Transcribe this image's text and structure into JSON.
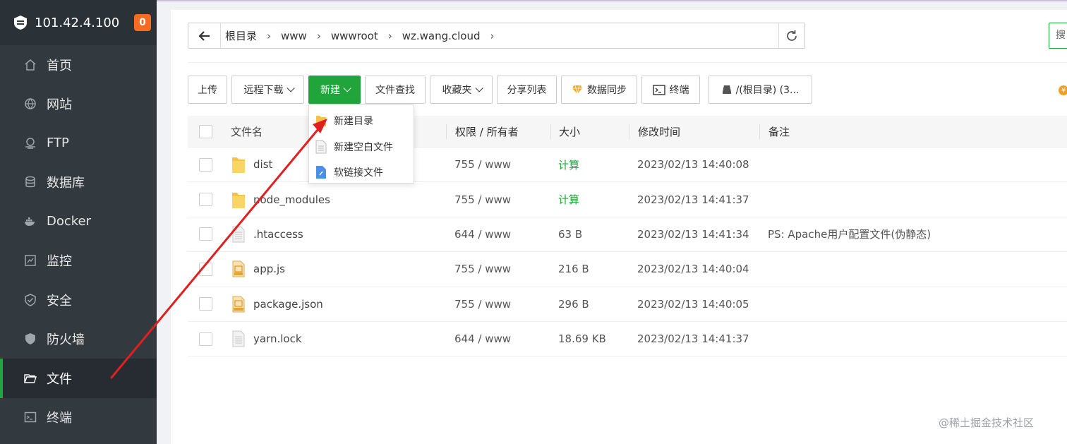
{
  "sidebar": {
    "server_ip": "101.42.4.100",
    "notification_count": "0",
    "items": [
      {
        "label": "首页",
        "icon": "home-icon"
      },
      {
        "label": "网站",
        "icon": "globe-icon"
      },
      {
        "label": "FTP",
        "icon": "ftp-icon"
      },
      {
        "label": "数据库",
        "icon": "database-icon"
      },
      {
        "label": "Docker",
        "icon": "docker-icon"
      },
      {
        "label": "监控",
        "icon": "monitor-icon"
      },
      {
        "label": "安全",
        "icon": "shield-check-icon"
      },
      {
        "label": "防火墙",
        "icon": "firewall-icon"
      },
      {
        "label": "文件",
        "icon": "folder-open-icon",
        "active": true
      },
      {
        "label": "终端",
        "icon": "terminal-icon"
      }
    ]
  },
  "path": {
    "crumbs": [
      "根目录",
      "www",
      "wwwroot",
      "wz.wang.cloud"
    ],
    "search_placeholder": "搜"
  },
  "toolbar": {
    "upload": "上传",
    "remote_download": "远程下载",
    "new": "新建",
    "file_search": "文件查找",
    "favorites": "收藏夹",
    "share_list": "分享列表",
    "data_sync": "数据同步",
    "terminal": "终端",
    "disk": "/(根目录) (3..."
  },
  "new_menu": {
    "items": [
      "新建目录",
      "新建空白文件",
      "软链接文件"
    ]
  },
  "table": {
    "headers": {
      "name": "文件名",
      "perm": "权限 / 所有者",
      "size": "大小",
      "mtime": "修改时间",
      "note": "备注"
    },
    "rows": [
      {
        "type": "folder",
        "name": "dist",
        "perm": "755 / www",
        "size": "计算",
        "mtime": "2023/02/13 14:40:08",
        "note": ""
      },
      {
        "type": "folder",
        "name": "node_modules",
        "perm": "755 / www",
        "size": "计算",
        "mtime": "2023/02/13 14:41:37",
        "note": ""
      },
      {
        "type": "file",
        "name": ".htaccess",
        "perm": "644 / www",
        "size": "63 B",
        "mtime": "2023/02/13 14:41:34",
        "note": "PS: Apache用户配置文件(伪静态)"
      },
      {
        "type": "js",
        "name": "app.js",
        "perm": "755 / www",
        "size": "216 B",
        "mtime": "2023/02/13 14:40:04",
        "note": ""
      },
      {
        "type": "json",
        "name": "package.json",
        "perm": "755 / www",
        "size": "296 B",
        "mtime": "2023/02/13 14:40:05",
        "note": ""
      },
      {
        "type": "file",
        "name": "yarn.lock",
        "perm": "644 / www",
        "size": "18.69 KB",
        "mtime": "2023/02/13 14:41:37",
        "note": ""
      }
    ]
  },
  "watermark": "@稀土掘金技术社区",
  "colors": {
    "accent": "#20a53a",
    "sidebar_bg": "#32393f",
    "badge": "#f36c21",
    "annotation_arrow": "#e02020"
  }
}
